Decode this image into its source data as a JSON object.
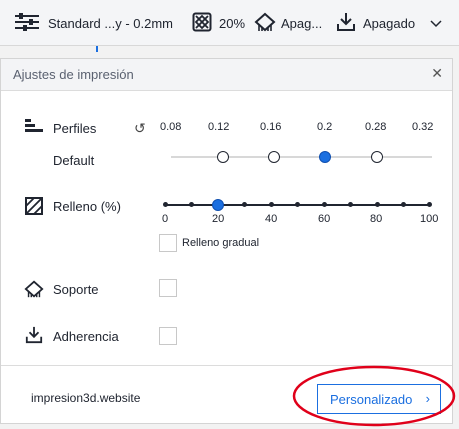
{
  "toolbar": {
    "profile_label": "Standard ...y - 0.2mm",
    "infill_label": "20%",
    "support_label": "Apag...",
    "adhesion_label": "Apagado"
  },
  "panel": {
    "title": "Ajustes de impresión",
    "profiles": {
      "label": "Perfiles",
      "sub_label": "Default",
      "tick_labels": [
        "0.08",
        "0.12",
        "0.16",
        "0.2",
        "0.28",
        "0.32"
      ],
      "selected": "0.2"
    },
    "infill": {
      "label": "Relleno (%)",
      "tick_labels": [
        "0",
        "20",
        "40",
        "60",
        "80",
        "100"
      ],
      "value": 20,
      "gradual_label": "Relleno gradual",
      "gradual_checked": false
    },
    "support": {
      "label": "Soporte",
      "checked": false
    },
    "adhesion": {
      "label": "Adherencia",
      "checked": false
    },
    "footer": {
      "website": "impresion3d.website",
      "custom_button": "Personalizado"
    }
  },
  "colors": {
    "accent": "#1b6fe0",
    "annotation": "#e0001a"
  }
}
